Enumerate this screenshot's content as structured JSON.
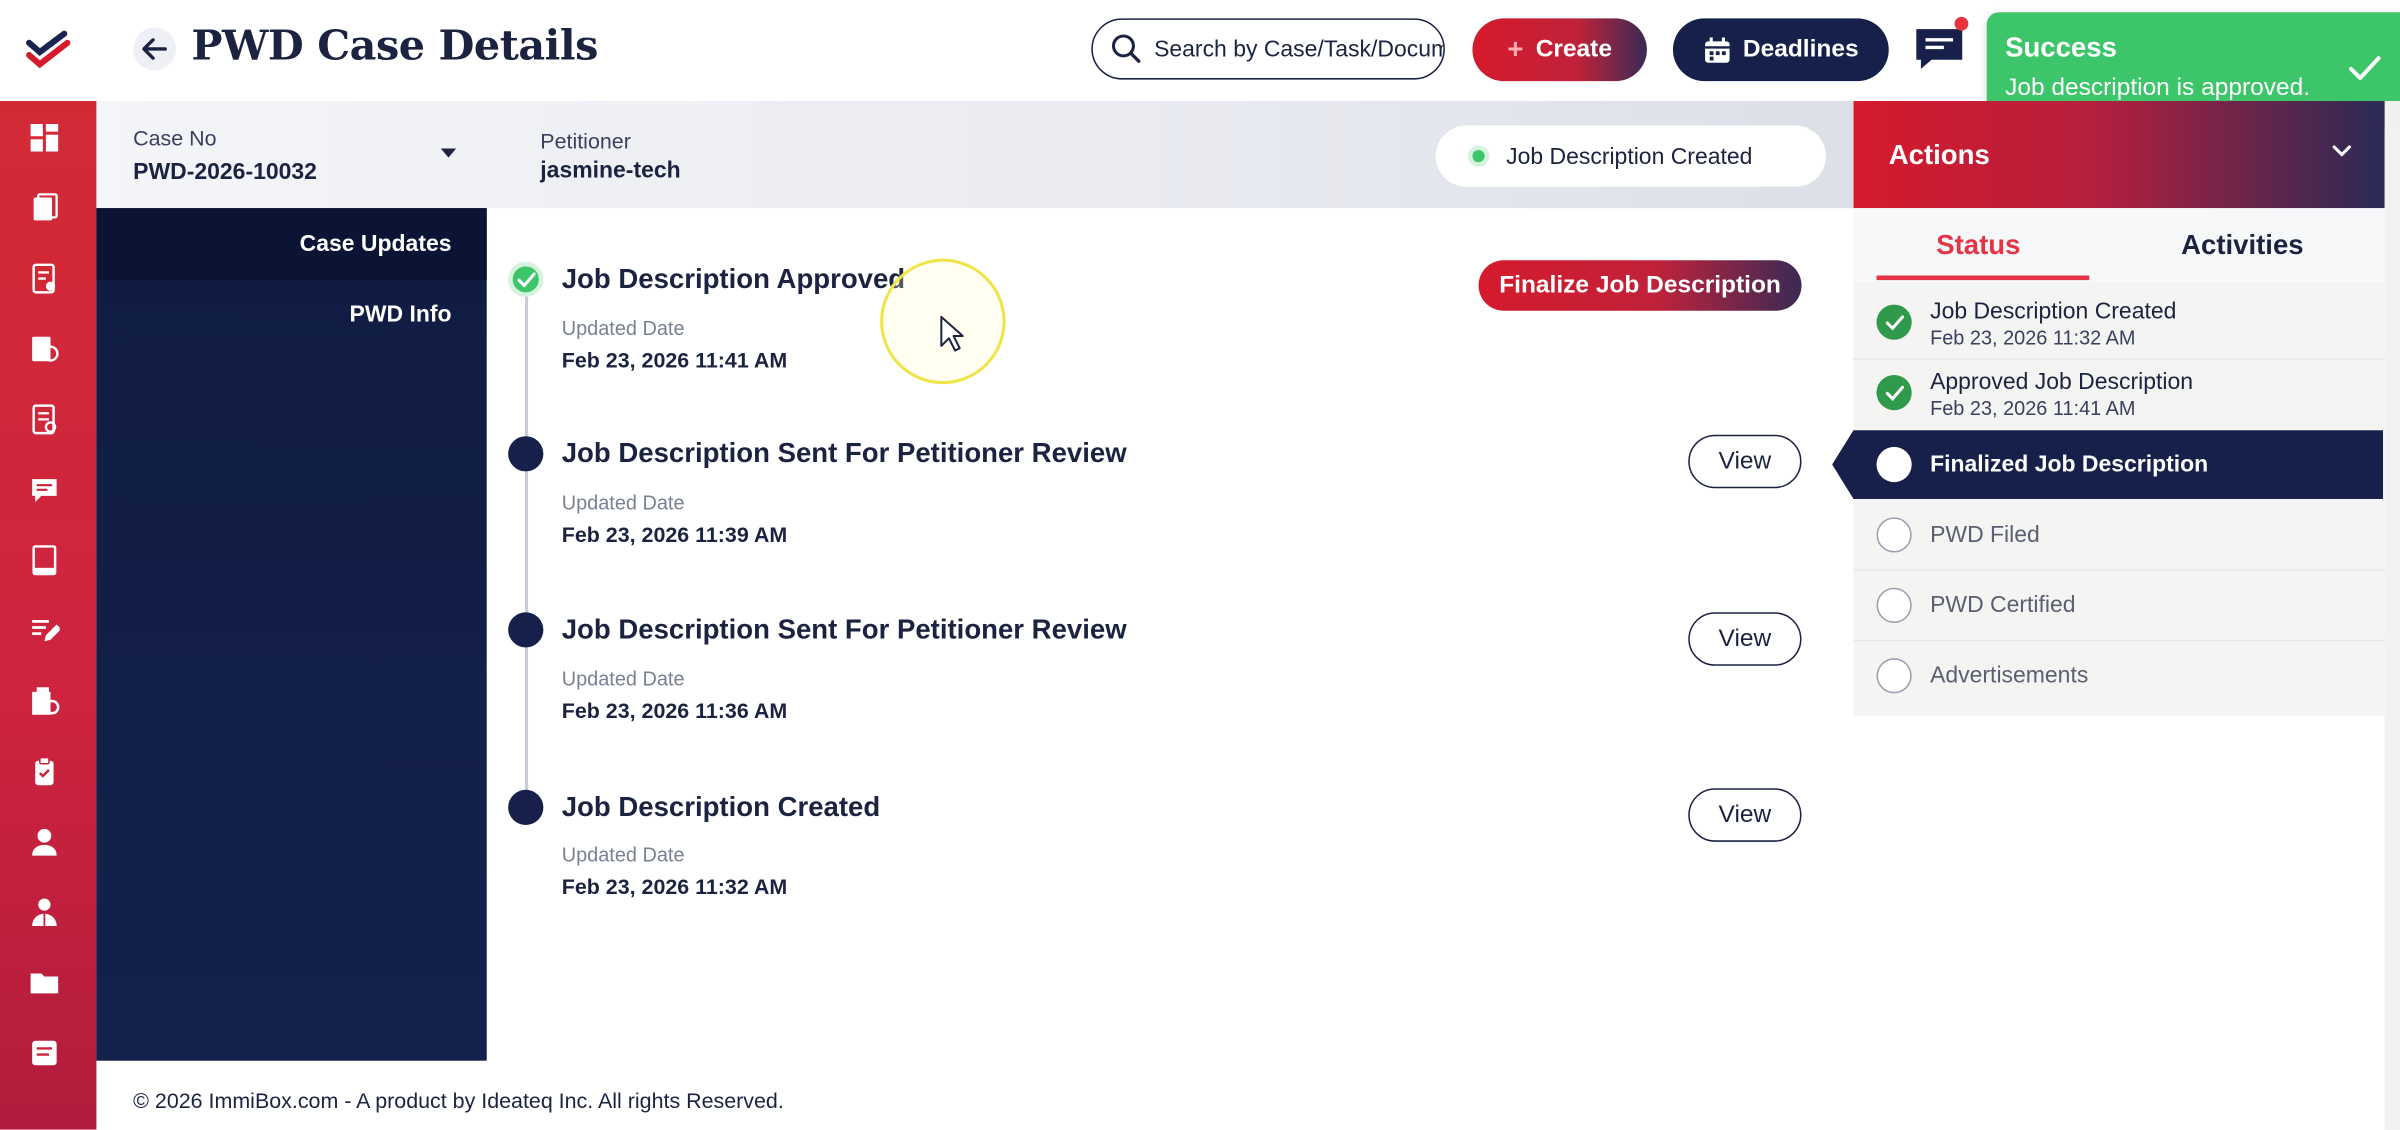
{
  "header": {
    "title": "PWD Case Details",
    "search_placeholder": "Search by Case/Task/Document",
    "create_label": "Create",
    "deadlines_label": "Deadlines"
  },
  "toast": {
    "title": "Success",
    "message": "Job description is approved."
  },
  "case": {
    "case_no_label": "Case No",
    "case_no": "PWD-2026-10032",
    "petitioner_label": "Petitioner",
    "petitioner": "jasmine-tech",
    "status": "Job Description Created"
  },
  "side_nav": {
    "items": [
      {
        "label": "Case Updates"
      },
      {
        "label": "PWD Info"
      }
    ]
  },
  "timeline": {
    "finalize_label": "Finalize Job Description",
    "view_label": "View",
    "items": [
      {
        "title": "Job Description Approved",
        "date_label": "Updated Date",
        "date": "Feb 23, 2026 11:41 AM"
      },
      {
        "title": "Job Description Sent For Petitioner Review",
        "date_label": "Updated Date",
        "date": "Feb 23, 2026 11:39 AM"
      },
      {
        "title": "Job Description Sent For Petitioner Review",
        "date_label": "Updated Date",
        "date": "Feb 23, 2026 11:36 AM"
      },
      {
        "title": "Job Description Created",
        "date_label": "Updated Date",
        "date": "Feb 23, 2026 11:32 AM"
      }
    ]
  },
  "actions": {
    "title": "Actions",
    "tabs": [
      {
        "label": "Status"
      },
      {
        "label": "Activities"
      }
    ],
    "steps": [
      {
        "label": "Job Description Created",
        "date": "Feb 23, 2026 11:32 AM",
        "state": "done"
      },
      {
        "label": "Approved Job Description",
        "date": "Feb 23, 2026 11:41 AM",
        "state": "done"
      },
      {
        "label": "Finalized Job Description",
        "state": "current"
      },
      {
        "label": "PWD Filed",
        "state": "todo"
      },
      {
        "label": "PWD Certified",
        "state": "todo"
      },
      {
        "label": "Advertisements",
        "state": "todo"
      }
    ]
  },
  "footer": {
    "text": "© 2026 ImmiBox.com - A product by Ideateq Inc. All rights Reserved."
  },
  "colors": {
    "brand_red": "#d51a2c",
    "navy": "#16204a",
    "success_green": "#3dc56a"
  }
}
